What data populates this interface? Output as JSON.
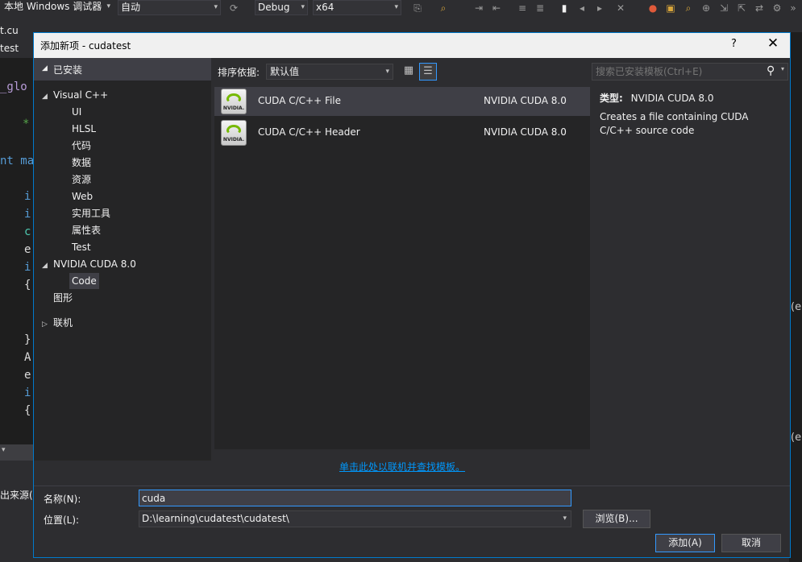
{
  "ide": {
    "config_combo": "本地 Windows 调试器",
    "auto_combo": "自动",
    "debug_combo": "Debug",
    "platform_combo": "x64",
    "tab_file": "t.cu",
    "tab_project": "test",
    "code_fragments": [
      "_glo",
      "*",
      "nt ma",
      "i",
      "i",
      "c",
      "e",
      "i",
      "{",
      "}",
      "A",
      "e",
      "i",
      "{"
    ],
    "output_label": "出来源(S)",
    "right_fragments": [
      "(e",
      "(e"
    ]
  },
  "dialog": {
    "title": "添加新项 - cudatest",
    "help_label": "?",
    "close_label": "✕"
  },
  "tree": {
    "installed_label": "已安装",
    "visual_cpp": "Visual C++",
    "vc_children": [
      "UI",
      "HLSL",
      "代码",
      "数据",
      "资源",
      "Web",
      "实用工具",
      "属性表",
      "Test"
    ],
    "nvidia": "NVIDIA CUDA 8.0",
    "nvidia_children": [
      "Code"
    ],
    "graphics": "图形",
    "online": "联机"
  },
  "toolbar": {
    "sort_label": "排序依据:",
    "sort_value": "默认值"
  },
  "templates": [
    {
      "name": "CUDA C/C++ File",
      "language": "NVIDIA CUDA 8.0",
      "icon": "nvidia-icon",
      "icon_text": "NVIDIA."
    },
    {
      "name": "CUDA C/C++ Header",
      "language": "NVIDIA CUDA 8.0",
      "icon": "nvidia-icon",
      "icon_text": "NVIDIA."
    }
  ],
  "online_link": "单击此处以联机并查找模板。",
  "details": {
    "search_placeholder": "搜索已安装模板(Ctrl+E)",
    "type_label": "类型:",
    "type_value": "NVIDIA CUDA 8.0",
    "description": "Creates a file containing CUDA C/C++ source code"
  },
  "form": {
    "name_label": "名称(N):",
    "name_value": "cuda",
    "location_label": "位置(L):",
    "location_value": "D:\\learning\\cudatest\\cudatest\\",
    "browse_label": "浏览(B)...",
    "add_label": "添加(A)",
    "cancel_label": "取消"
  },
  "colors": {
    "accent": "#007acc",
    "selection": "#3f3f46",
    "link": "#0097fb",
    "nvidia_green": "#76b900"
  }
}
